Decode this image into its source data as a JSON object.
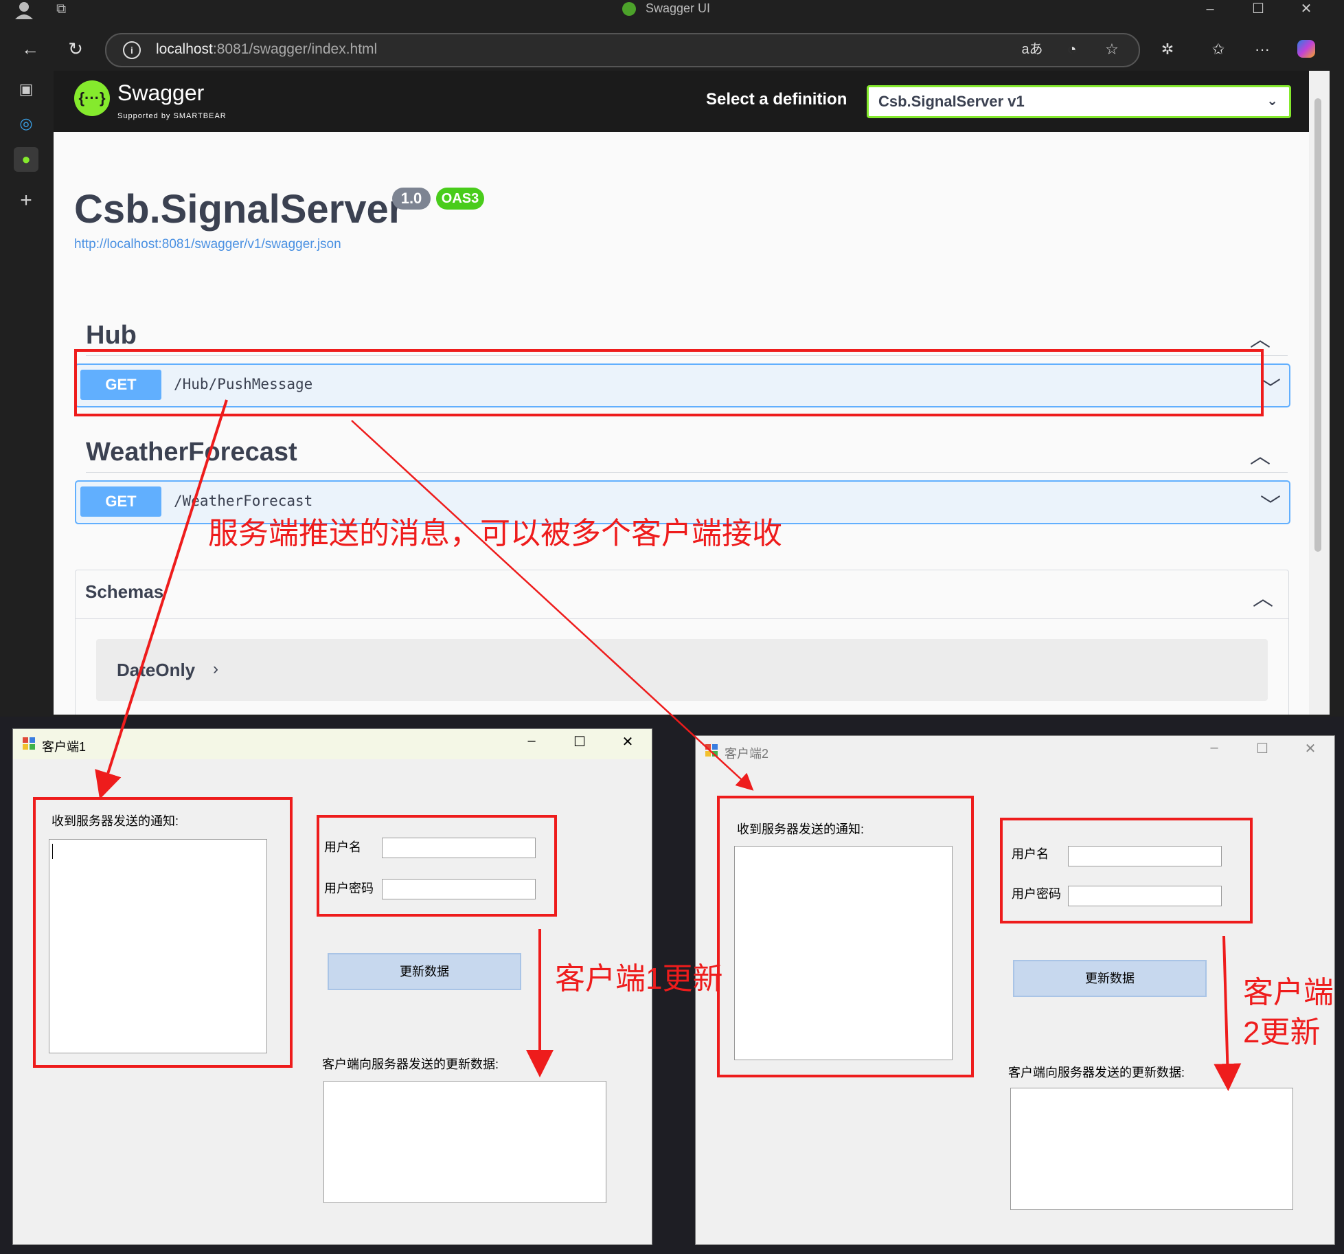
{
  "browser": {
    "tab_title": "Swagger UI",
    "url_host": "localhost",
    "url_rest": ":8081/swagger/index.html",
    "icons": [
      "profile-icon",
      "tabs-icon",
      "back-icon",
      "refresh-icon",
      "info-icon",
      "read-aloud-icon",
      "edge-icon",
      "favorite-icon",
      "extensions-icon",
      "favorites-bar-icon",
      "more-icon",
      "copilot-icon"
    ]
  },
  "swagger": {
    "brand": "Swagger",
    "supported_by": "Supported by SMARTBEAR",
    "select_definition_label": "Select a definition",
    "definition_value": "Csb.SignalServer v1",
    "api_title": "Csb.SignalServer",
    "version": "1.0",
    "oas": "OAS3",
    "spec_url": "http://localhost:8081/swagger/v1/swagger.json",
    "tags": [
      {
        "name": "Hub",
        "method": "GET",
        "path": "/Hub/PushMessage"
      },
      {
        "name": "WeatherForecast",
        "method": "GET",
        "path": "/WeatherForecast"
      }
    ],
    "schemas_title": "Schemas",
    "schema_models": [
      "DateOnly"
    ]
  },
  "client1": {
    "title": "客户端1",
    "received_label": "收到服务器发送的通知:",
    "username_label": "用户名",
    "password_label": "用户密码",
    "update_button": "更新数据",
    "sent_label": "客户端向服务器发送的更新数据:"
  },
  "client2": {
    "title": "客户端2",
    "received_label": "收到服务器发送的通知:",
    "username_label": "用户名",
    "password_label": "用户密码",
    "update_button": "更新数据",
    "sent_label": "客户端向服务器发送的更新数据:"
  },
  "annotations": {
    "main_note": "服务端推送的消息，可以被多个客户端接收",
    "client1_note": "客户端1更新",
    "client2_note_line1": "客户端",
    "client2_note_line2": "2更新"
  },
  "colors": {
    "annotation": "#ee1c1c",
    "get_method": "#61affe",
    "swagger_green": "#85ea2d"
  }
}
